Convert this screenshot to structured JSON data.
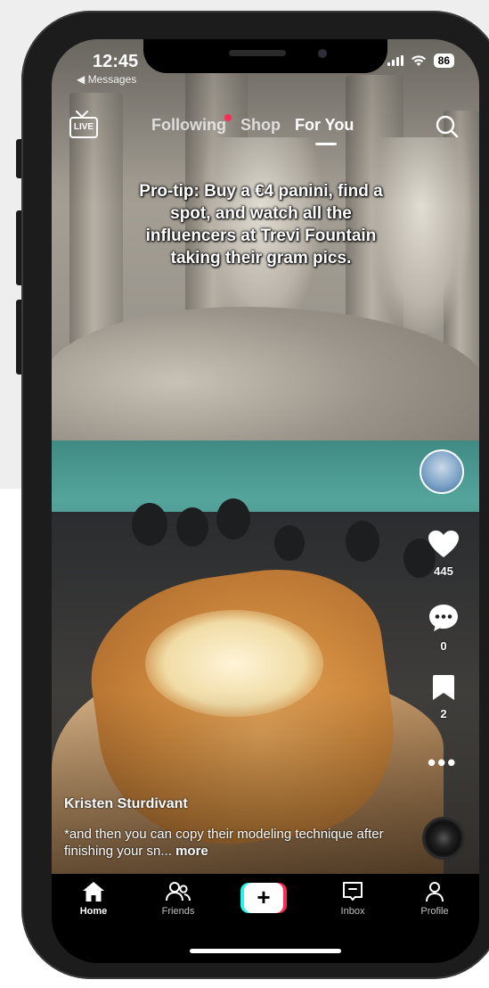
{
  "status_bar": {
    "time": "12:45",
    "back_label": "◀ Messages",
    "battery": "86"
  },
  "top_nav": {
    "live_label": "LIVE",
    "tabs": [
      {
        "label": "Following",
        "has_notification_dot": true
      },
      {
        "label": "Shop"
      },
      {
        "label": "For You",
        "active": true
      }
    ]
  },
  "video": {
    "overlay_text": "Pro-tip: Buy a €4 panini, find a spot, and watch all the influencers at Trevi Fountain taking their gram pics.",
    "author": "Kristen Sturdivant",
    "description": "*and then you can copy their modeling technique after finishing your sn...",
    "more_label": "more"
  },
  "actions": {
    "likes": "445",
    "comments": "0",
    "saves": "2"
  },
  "bottom_nav": {
    "items": [
      {
        "label": "Home",
        "icon": "home-icon",
        "active": true
      },
      {
        "label": "Friends",
        "icon": "friends-icon"
      },
      {
        "label": "",
        "icon": "plus-icon"
      },
      {
        "label": "Inbox",
        "icon": "inbox-icon"
      },
      {
        "label": "Profile",
        "icon": "profile-icon"
      }
    ]
  },
  "colors": {
    "accent_red": "#fe2c55",
    "accent_cyan": "#25f4ee"
  }
}
